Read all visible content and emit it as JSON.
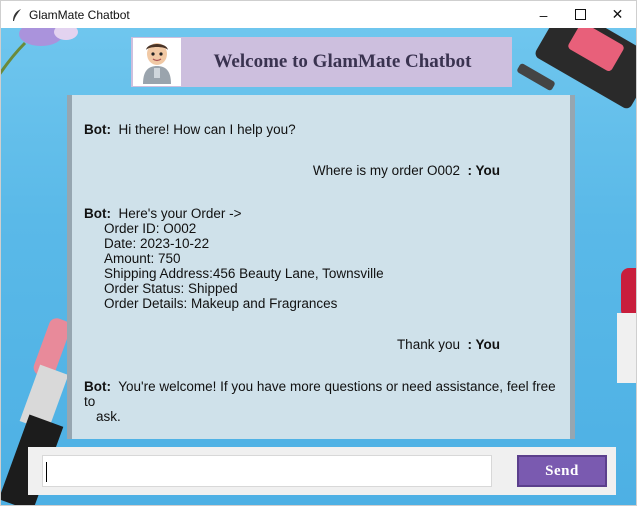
{
  "window": {
    "title": "GlamMate Chatbot",
    "controls": {
      "minimize": "–",
      "maximize": "☐",
      "close": "✕"
    }
  },
  "header": {
    "title": "Welcome to GlamMate Chatbot"
  },
  "chat": {
    "messages": [
      {
        "sender": "Bot:",
        "text": "Hi there! How can I help you?"
      },
      {
        "sender": ": You",
        "text": "Where is my order O002"
      },
      {
        "sender": "Bot:",
        "text": "Here's your Order ->",
        "details": [
          "Order ID: O002",
          "Date: 2023-10-22",
          "Amount: 750",
          "Shipping Address:456 Beauty Lane, Townsville",
          "Order Status: Shipped",
          "Order Details: Makeup and Fragrances"
        ]
      },
      {
        "sender": ": You",
        "text": "Thank you"
      },
      {
        "sender": "Bot:",
        "text": "You're welcome! If you have more questions or need assistance, feel free to",
        "text_cont": "ask."
      }
    ]
  },
  "input": {
    "value": "",
    "send_label": "Send"
  },
  "colors": {
    "banner": "#cdbfde",
    "chat_bg": "#cfe1ea",
    "send_button": "#7a5ab0",
    "background": "#5ab9e8"
  }
}
